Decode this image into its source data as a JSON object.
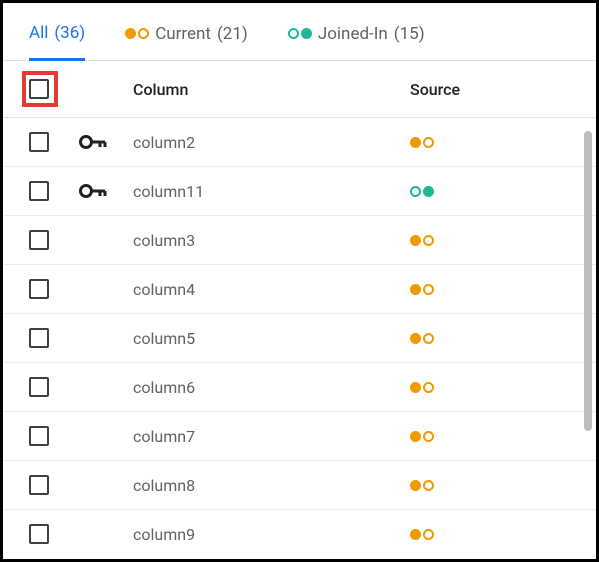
{
  "colors": {
    "accent_blue": "#1a73e8",
    "orange": "#f29900",
    "teal": "#1db898"
  },
  "tabs": {
    "all": {
      "label": "All",
      "count": "(36)"
    },
    "current": {
      "label": "Current",
      "count": "(21)"
    },
    "joined": {
      "label": "Joined-In",
      "count": "(15)"
    }
  },
  "header": {
    "column_label": "Column",
    "source_label": "Source"
  },
  "rows": [
    {
      "name": "column2",
      "is_key": true,
      "source": "current"
    },
    {
      "name": "column11",
      "is_key": true,
      "source": "joined"
    },
    {
      "name": "column3",
      "is_key": false,
      "source": "current"
    },
    {
      "name": "column4",
      "is_key": false,
      "source": "current"
    },
    {
      "name": "column5",
      "is_key": false,
      "source": "current"
    },
    {
      "name": "column6",
      "is_key": false,
      "source": "current"
    },
    {
      "name": "column7",
      "is_key": false,
      "source": "current"
    },
    {
      "name": "column8",
      "is_key": false,
      "source": "current"
    },
    {
      "name": "column9",
      "is_key": false,
      "source": "current"
    }
  ]
}
